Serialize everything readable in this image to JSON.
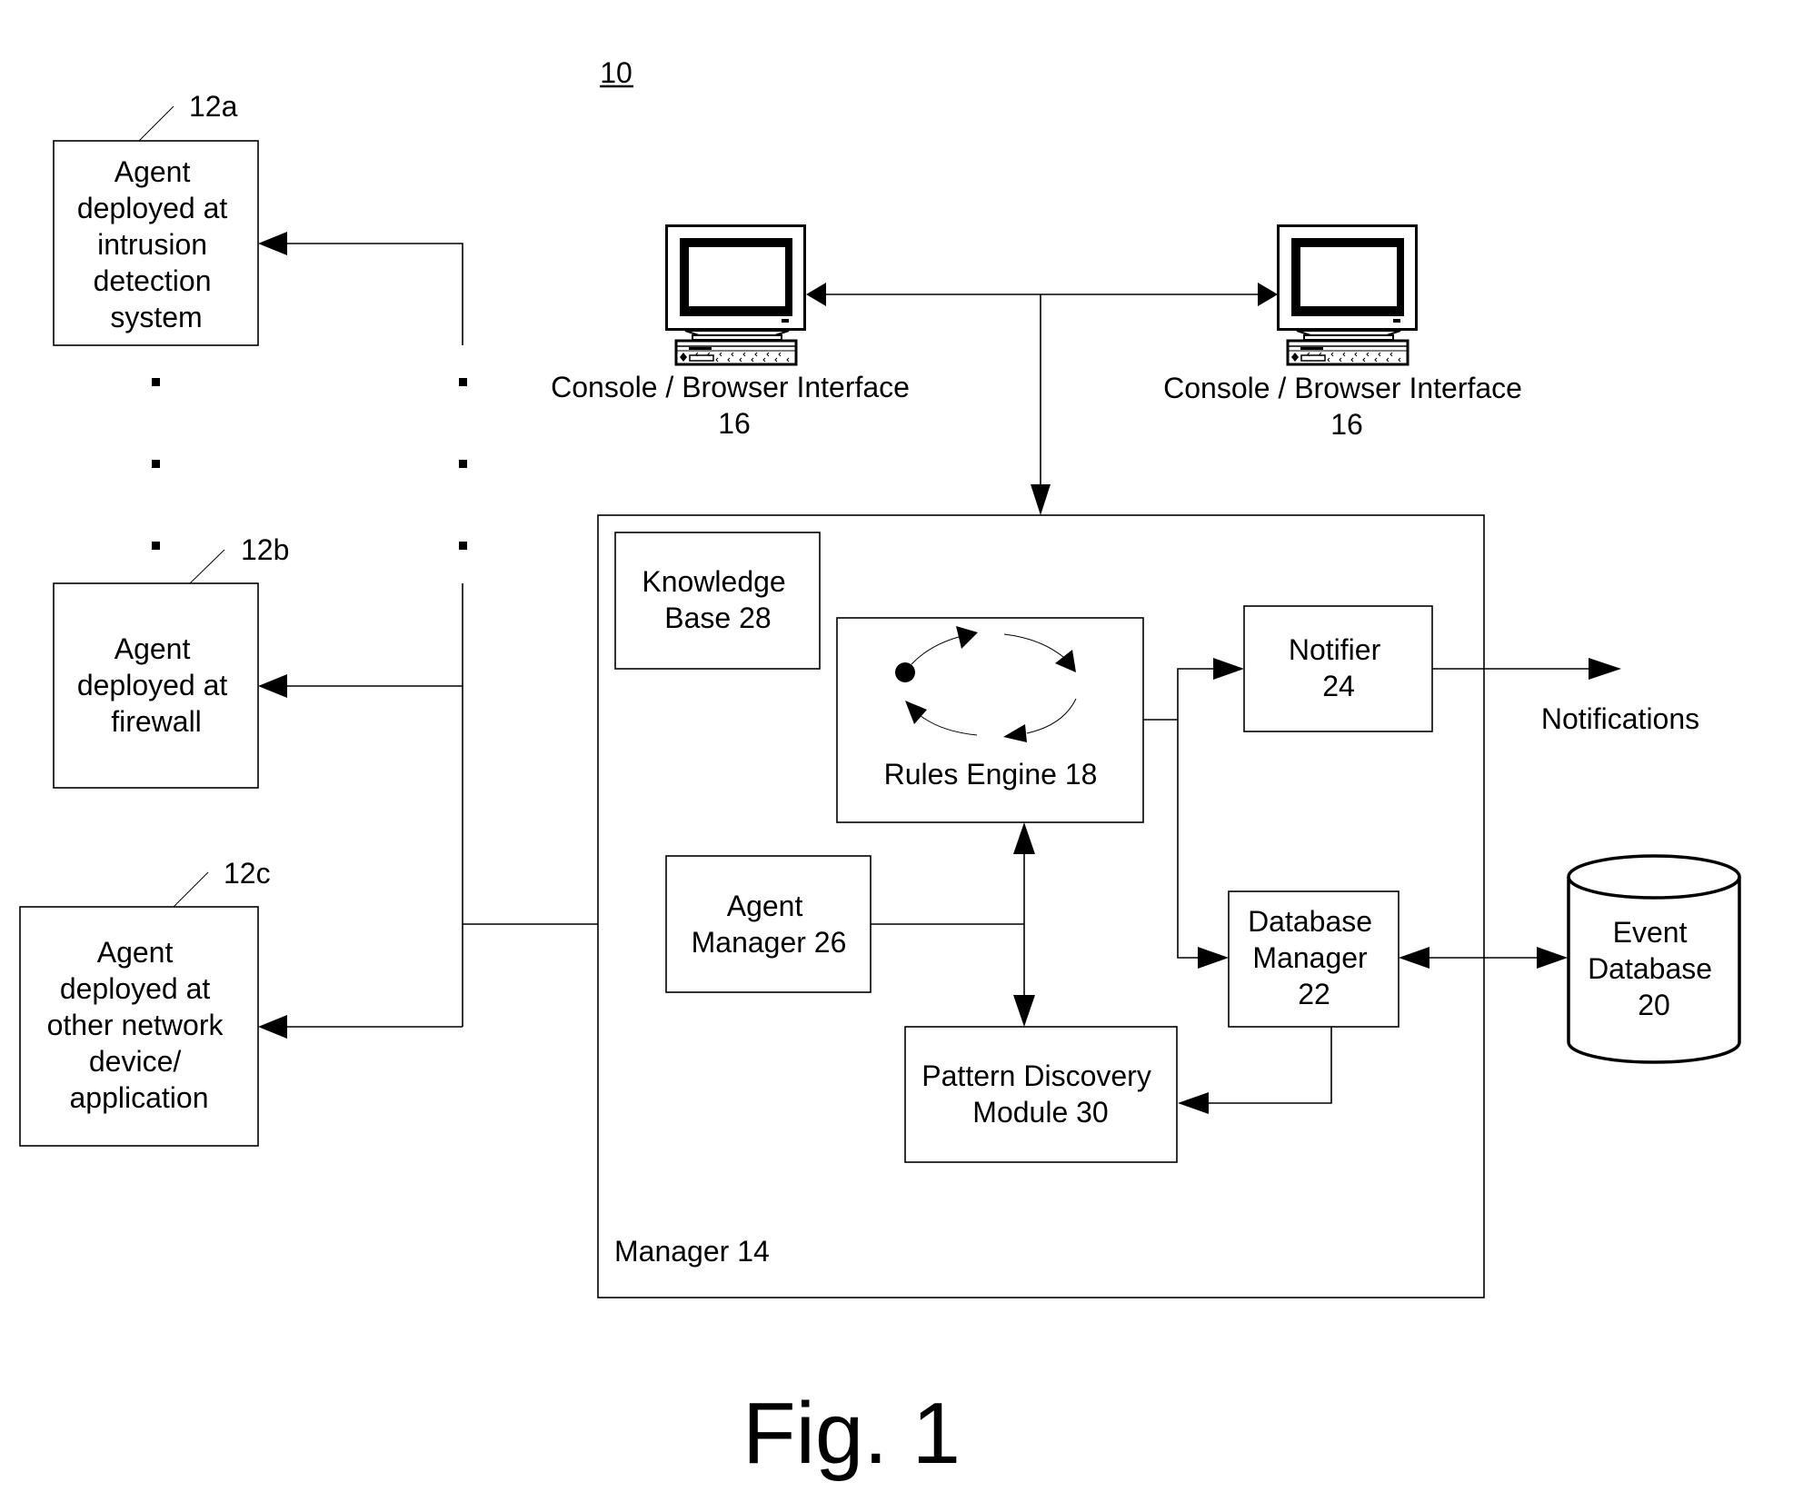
{
  "figure": {
    "system_ref": "10",
    "caption": "Fig. 1"
  },
  "agents": [
    {
      "ref": "12a",
      "lines": [
        "Agent",
        "deployed at",
        "intrusion",
        "detection",
        "system"
      ]
    },
    {
      "ref": "12b",
      "lines": [
        "Agent",
        "deployed at",
        "firewall"
      ]
    },
    {
      "ref": "12c",
      "lines": [
        "Agent",
        "deployed at",
        "other network",
        "device/",
        "application"
      ]
    }
  ],
  "consoles": [
    {
      "label": "Console / Browser Interface",
      "ref": "16",
      "icon": "computer-monitor-icon"
    },
    {
      "label": "Console / Browser Interface",
      "ref": "16",
      "icon": "computer-monitor-icon"
    }
  ],
  "manager": {
    "label": "Manager 14",
    "knowledge_base": [
      "Knowledge",
      "Base 28"
    ],
    "rules_engine": {
      "label": "Rules Engine 18",
      "icon": "cycle-arrows-icon"
    },
    "notifier": [
      "Notifier",
      "24"
    ],
    "agent_manager": [
      "Agent",
      "Manager 26"
    ],
    "database_manager": [
      "Database",
      "Manager",
      "22"
    ],
    "pattern_discovery": [
      "Pattern Discovery",
      "Module 30"
    ]
  },
  "event_database": [
    "Event",
    "Database",
    "20"
  ],
  "notifications_label": "Notifications",
  "ellipsis_icon": "vertical-ellipsis-dots"
}
